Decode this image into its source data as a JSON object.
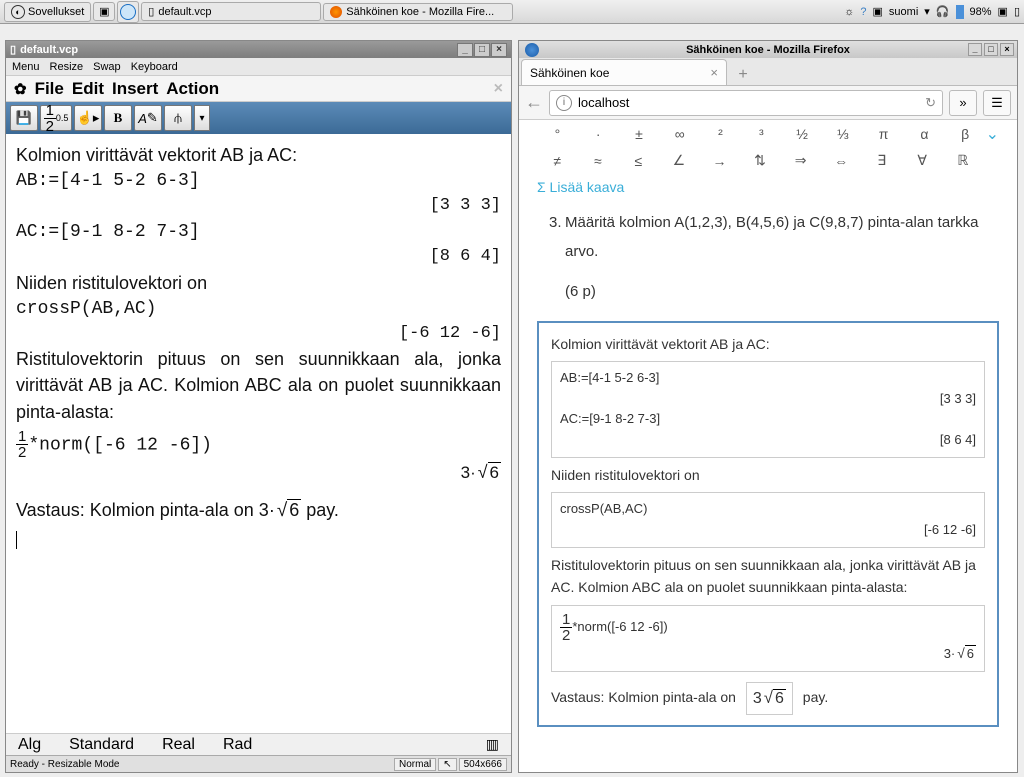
{
  "taskbar": {
    "apps": "Sovellukset",
    "vcp_task": "default.vcp",
    "ff_task": "Sähköinen koe - Mozilla Fire...",
    "lang": "suomi",
    "battery": "98%"
  },
  "vcp": {
    "title": "default.vcp",
    "menus": [
      "Menu",
      "Resize",
      "Swap",
      "Keyboard"
    ],
    "appmenu": [
      "File",
      "Edit",
      "Insert",
      "Action"
    ],
    "content": {
      "l1": "Kolmion virittävät vektorit AB ja AC:",
      "l2": "AB:=[4-1 5-2 6-3]",
      "r2": "[3 3 3]",
      "l3": "AC:=[9-1 8-2 7-3]",
      "r3": "[8 6 4]",
      "l4": "Niiden ristitulovektori on",
      "l5": "crossP(AB,AC)",
      "r5": "[-6 12 -6]",
      "l6": "Ristitulovektorin pituus on sen suunnikkaan ala, jonka virittävät AB ja AC. Kolmion ABC ala on puolet suunnikkaan pinta-alasta:",
      "l7a": "*norm([-6 12 -6])",
      "r7a": "3·",
      "r7b": "6",
      "l8a": "Vastaus: Kolmion pinta-ala on 3·",
      "l8b": "6",
      "l8c": " pay."
    },
    "botmenu": [
      "Alg",
      "Standard",
      "Real",
      "Rad"
    ],
    "status": {
      "left": "Ready - Resizable Mode",
      "mode": "Normal",
      "dim": "504x666"
    }
  },
  "firefox": {
    "title": "Sähköinen koe - Mozilla Firefox",
    "tab": "Sähköinen koe",
    "url": "localhost",
    "symrow1": [
      "°",
      "·",
      "±",
      "∞",
      "²",
      "³",
      "½",
      "⅓",
      "π",
      "α",
      "β"
    ],
    "symrow2": [
      "≠",
      "≈",
      "≤",
      "∠",
      "→",
      "⇅",
      "⇒",
      "⇔",
      "∃",
      "∀",
      "ℝ"
    ],
    "addform": "Σ Lisää kaava",
    "question": {
      "num": "3.",
      "text": "Määritä kolmion A(1,2,3), B(4,5,6) ja C(9,8,7) pinta-alan tarkka arvo.",
      "points": "(6 p)"
    },
    "answer": {
      "l1": "Kolmion virittävät vektorit AB ja AC:",
      "c1": "AB:=[4-1 5-2 6-3]",
      "r1": "[3 3 3]",
      "c2": "AC:=[9-1 8-2 7-3]",
      "r2": "[8 6 4]",
      "l2": "Niiden ristitulovektori on",
      "c3": "crossP(AB,AC)",
      "r3": "[-6 12 -6]",
      "l3": "Ristitulovektorin pituus on sen suunnikkaan ala, jonka virittävät AB ja AC. Kolmion ABC ala on puolet suunnikkaan pinta-alasta:",
      "c4": "*norm([-6 12 -6])",
      "r4a": "3·",
      "r4b": "6",
      "l4a": "Vastaus: Kolmion pinta-ala on ",
      "l4b": "6",
      "l4c": " pay."
    }
  },
  "chart_data": null
}
